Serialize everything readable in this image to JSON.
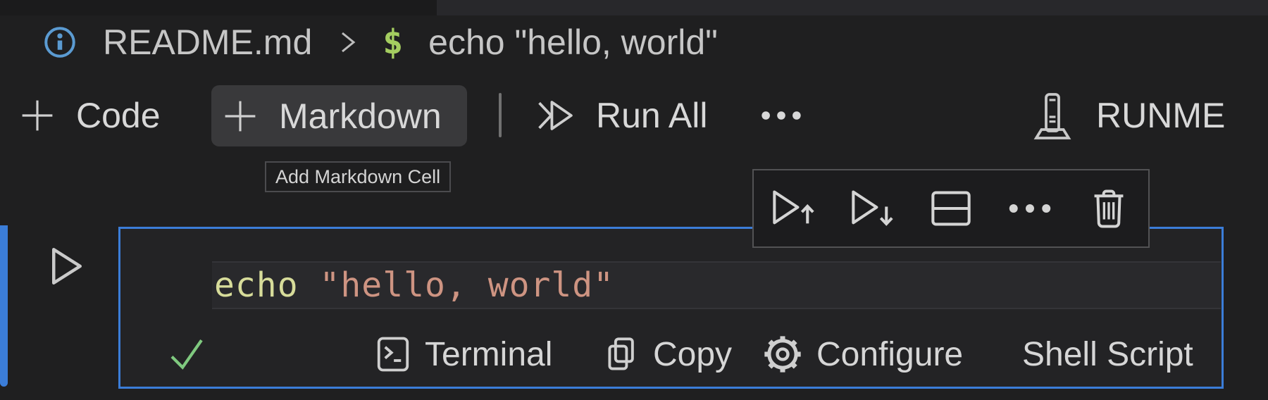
{
  "colors": {
    "accent": "#3b7dd8",
    "success_green": "#7fc97f",
    "prompt_green": "#a4cd60",
    "info_blue": "#5b9bd2",
    "code_keyword": "#d7dc9a",
    "code_string": "#ce9482",
    "text_primary": "#d6d6d6"
  },
  "breadcrumb": {
    "file_name": "README.md",
    "separator": ">",
    "cell_symbol": "$",
    "cell_command": "echo \"hello, world\""
  },
  "toolbar": {
    "add_code_label": "Code",
    "add_markdown_label": "Markdown",
    "run_all_label": "Run All",
    "brand_label": "RUNME"
  },
  "tooltip": {
    "text": "Add Markdown Cell"
  },
  "cell_toolbar": {
    "buttons": [
      "execute-above-cells",
      "execute-cell-and-below",
      "split-cell",
      "more-actions",
      "delete-cell"
    ]
  },
  "cell": {
    "code_tokens": [
      {
        "text": "echo ",
        "type": "keyword"
      },
      {
        "text": "\"hello, world\"",
        "type": "string"
      }
    ],
    "statusbar": {
      "terminal_label": "Terminal",
      "copy_label": "Copy",
      "configure_label": "Configure",
      "language_label": "Shell Script"
    }
  }
}
